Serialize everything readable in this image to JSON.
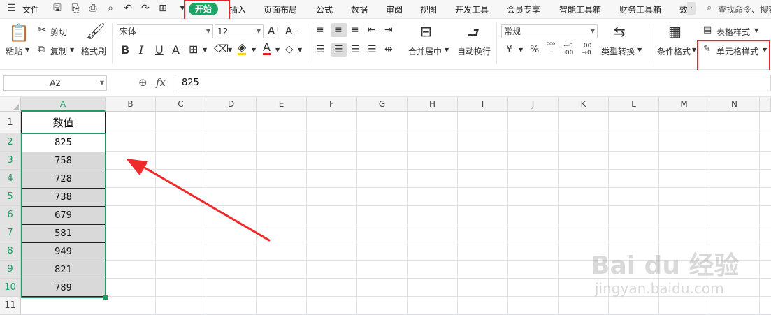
{
  "menu": {
    "file_label": "文件",
    "start_label": "开始",
    "tabs": [
      "插入",
      "页面布局",
      "公式",
      "数据",
      "审阅",
      "视图",
      "开发工具",
      "会员专享",
      "智能工具箱",
      "财务工具箱",
      "效"
    ],
    "search_placeholder": "查找命令、搜索"
  },
  "ribbon": {
    "paste": "粘贴",
    "cut": "剪切",
    "copy": "复制",
    "format_painter": "格式刷",
    "font_name": "宋体",
    "font_size": "12",
    "merge_center": "合并居中",
    "wrap_text": "自动换行",
    "number_format": "常规",
    "type_convert": "类型转换",
    "conditional_format": "条件格式",
    "table_style": "表格样式",
    "cell_style": "单元格样式",
    "bold": "B",
    "italic": "I",
    "underline": "U",
    "currency": "¥",
    "percent": "%"
  },
  "formula_bar": {
    "name_box": "A2",
    "fx_label": "fx",
    "value": "825"
  },
  "sheet": {
    "columns": [
      "A",
      "B",
      "C",
      "D",
      "E",
      "F",
      "G",
      "H",
      "I",
      "J",
      "K",
      "L",
      "M",
      "N"
    ],
    "rows": [
      "1",
      "2",
      "3",
      "4",
      "5",
      "6",
      "7",
      "8",
      "9",
      "10",
      "11"
    ],
    "header_cell": "数值",
    "values": [
      "825",
      "758",
      "728",
      "738",
      "679",
      "581",
      "949",
      "821",
      "789"
    ]
  },
  "watermark": {
    "brand": "Bai du 经验",
    "url": "jingyan.baidu.com"
  },
  "colors": {
    "accent_green": "#1fa467",
    "highlight_red": "#e6262b",
    "selection_gray": "#d9d9d9"
  }
}
